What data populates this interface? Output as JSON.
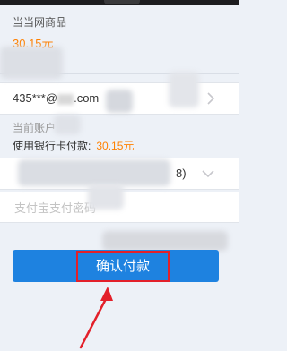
{
  "product": {
    "label": "当当网商品",
    "price": "30.15元"
  },
  "account": {
    "masked": "435***@",
    "domain": ".com"
  },
  "payment": {
    "current_account_label": "当前账户",
    "bankcard_label": "使用银行卡付款:",
    "bankcard_amount": "30.15元",
    "bankcard_suffix": "8)",
    "password_placeholder": "支付宝支付密码"
  },
  "confirm": {
    "label": "确认付款"
  },
  "icons": {
    "account_chevron": "chevron-right-icon",
    "bankcard_chevron": "chevron-down-icon",
    "annotation": "red-arrow-icon"
  },
  "colors": {
    "accent": "#ff8000",
    "button": "#1e82e0",
    "highlight": "#e3202a",
    "background": "#edf1f7"
  }
}
